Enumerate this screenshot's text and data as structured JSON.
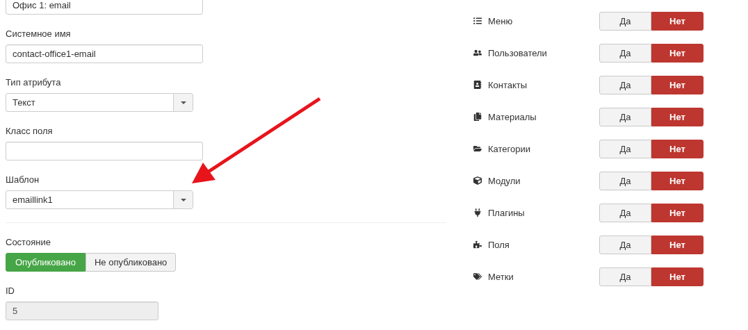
{
  "fields": [
    {
      "kind": "text",
      "value": "Офис 1: email"
    },
    {
      "label": "Системное имя",
      "kind": "text",
      "value": "contact-office1-email"
    },
    {
      "label": "Тип атрибута",
      "kind": "select",
      "value": "Текст"
    },
    {
      "label": "Класс поля",
      "kind": "text"
    },
    {
      "label": "Шаблон",
      "kind": "select",
      "value": "emaillink1"
    }
  ],
  "state": {
    "label": "Состояние",
    "options": [
      {
        "label": "Опубликовано",
        "selected": true
      },
      {
        "label": "Не опубликовано",
        "selected": false
      }
    ]
  },
  "id_field": {
    "label": "ID",
    "value": "5",
    "disabled": true
  },
  "permissions": [
    {
      "label": "Меню",
      "options": [
        {
          "label": "Да",
          "selected": false
        },
        {
          "label": "Нет",
          "selected": true
        }
      ]
    },
    {
      "label": "Пользователи",
      "options": [
        {
          "label": "Да",
          "selected": false
        },
        {
          "label": "Нет",
          "selected": true
        }
      ]
    },
    {
      "label": "Контакты",
      "options": [
        {
          "label": "Да",
          "selected": false
        },
        {
          "label": "Нет",
          "selected": true
        }
      ]
    },
    {
      "label": "Материалы",
      "options": [
        {
          "label": "Да",
          "selected": false
        },
        {
          "label": "Нет",
          "selected": true
        }
      ]
    },
    {
      "label": "Категории",
      "options": [
        {
          "label": "Да",
          "selected": false
        },
        {
          "label": "Нет",
          "selected": true
        }
      ]
    },
    {
      "label": "Модули",
      "options": [
        {
          "label": "Да",
          "selected": false
        },
        {
          "label": "Нет",
          "selected": true
        }
      ]
    },
    {
      "label": "Плагины",
      "options": [
        {
          "label": "Да",
          "selected": false
        },
        {
          "label": "Нет",
          "selected": true
        }
      ]
    },
    {
      "label": "Поля",
      "options": [
        {
          "label": "Да",
          "selected": false
        },
        {
          "label": "Нет",
          "selected": true
        }
      ]
    },
    {
      "label": "Метки",
      "options": [
        {
          "label": "Да",
          "selected": false
        },
        {
          "label": "Нет",
          "selected": true
        }
      ]
    }
  ]
}
